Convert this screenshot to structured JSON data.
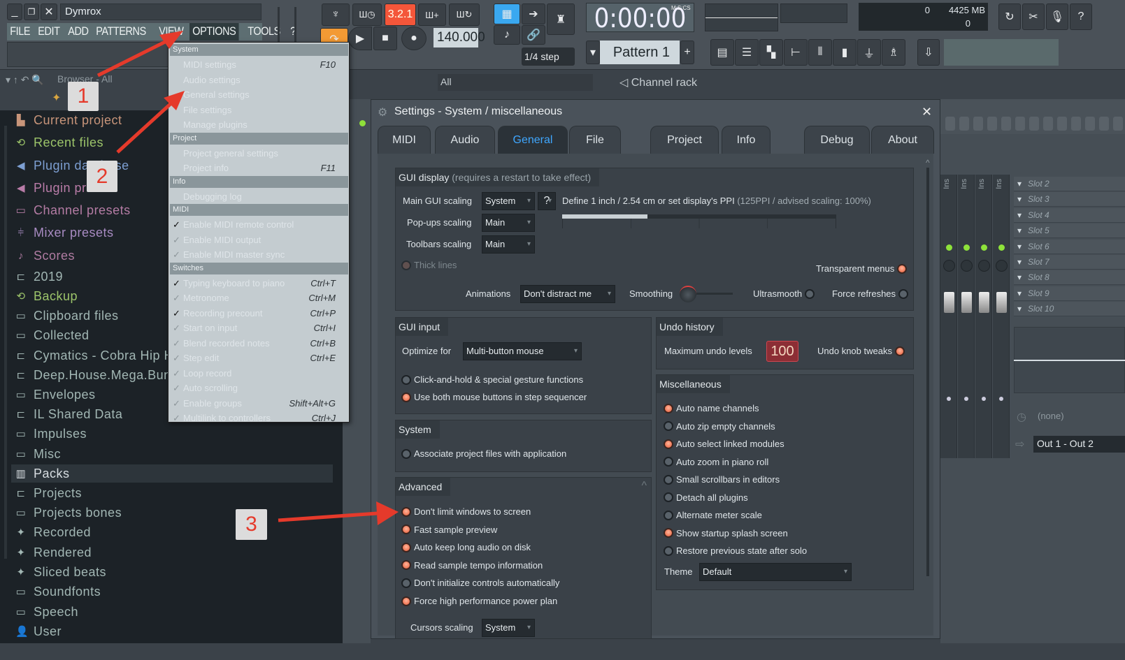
{
  "window": {
    "title": "Dymrox"
  },
  "menubar": [
    "FILE",
    "EDIT",
    "ADD",
    "PATTERNS",
    "VIEW",
    "OPTIONS",
    "TOOLS",
    "?"
  ],
  "menubar_active": "OPTIONS",
  "transport": {
    "bpm": "140.000",
    "time": "0:00:00",
    "time_format": "M:S:CS",
    "song_pos": "3.2.1",
    "step": "1/4 step",
    "pattern": "Pattern 1",
    "cpu": "0",
    "memory": "4425 MB",
    "polyphony": "0"
  },
  "browser": {
    "header": "Browser - All",
    "items": [
      {
        "label": "Current project",
        "icon": "project-icon",
        "color": "#c8957a"
      },
      {
        "label": "Recent files",
        "icon": "recent-folder-icon",
        "color": "#9cc46a"
      },
      {
        "label": "Plugin database",
        "icon": "plugin-icon",
        "color": "#7d9fd2"
      },
      {
        "label": "Plugin presets",
        "icon": "plugin-icon",
        "color": "#b97ca8"
      },
      {
        "label": "Channel presets",
        "icon": "channel-icon",
        "color": "#b47ca4"
      },
      {
        "label": "Mixer presets",
        "icon": "mixer-icon",
        "color": "#a88bc2"
      },
      {
        "label": "Scores",
        "icon": "note-icon",
        "color": "#b07ca2"
      },
      {
        "label": "2019",
        "icon": "folder-plus-icon",
        "color": "#a2b7b4"
      },
      {
        "label": "Backup",
        "icon": "recent-folder-icon",
        "color": "#9cc46a"
      },
      {
        "label": "Clipboard files",
        "icon": "folder-icon",
        "color": "#a2b7b4"
      },
      {
        "label": "Collected",
        "icon": "folder-icon",
        "color": "#a2b7b4"
      },
      {
        "label": "Cymatics - Cobra Hip Hop Sample Pack",
        "icon": "folder-plus-icon",
        "color": "#a2b7b4"
      },
      {
        "label": "Deep.House.Mega.Bundle.",
        "icon": "folder-plus-icon",
        "color": "#a2b7b4"
      },
      {
        "label": "Envelopes",
        "icon": "folder-icon",
        "color": "#a2b7b4"
      },
      {
        "label": "IL Shared Data",
        "icon": "folder-plus-icon",
        "color": "#a2b7b4"
      },
      {
        "label": "Impulses",
        "icon": "folder-icon",
        "color": "#a2b7b4"
      },
      {
        "label": "Misc",
        "icon": "folder-icon",
        "color": "#a2b7b4"
      },
      {
        "label": "Packs",
        "icon": "packs-icon",
        "color": "#d8dee2"
      },
      {
        "label": "Projects",
        "icon": "folder-plus-icon",
        "color": "#a2b7b4"
      },
      {
        "label": "Projects bones",
        "icon": "folder-icon",
        "color": "#a2b7b4"
      },
      {
        "label": "Recorded",
        "icon": "wave-icon",
        "color": "#a2b7b4"
      },
      {
        "label": "Rendered",
        "icon": "wave-icon",
        "color": "#a2b7b4"
      },
      {
        "label": "Sliced beats",
        "icon": "wave-icon",
        "color": "#a2b7b4"
      },
      {
        "label": "Soundfonts",
        "icon": "folder-icon",
        "color": "#a2b7b4"
      },
      {
        "label": "Speech",
        "icon": "folder-icon",
        "color": "#a2b7b4"
      },
      {
        "label": "User",
        "icon": "user-icon",
        "color": "#a2b7b4"
      }
    ]
  },
  "options_menu": [
    {
      "section": "System"
    },
    {
      "label": "MIDI settings",
      "shortcut": "F10"
    },
    {
      "label": "Audio settings"
    },
    {
      "label": "General settings"
    },
    {
      "label": "File settings"
    },
    {
      "label": "Manage plugins"
    },
    {
      "section": "Project"
    },
    {
      "label": "Project general settings"
    },
    {
      "label": "Project info",
      "shortcut": "F11"
    },
    {
      "section": "Info"
    },
    {
      "label": "Debugging log"
    },
    {
      "section": "MIDI"
    },
    {
      "label": "Enable MIDI remote control",
      "checked": true
    },
    {
      "label": "Enable MIDI output",
      "checked": false
    },
    {
      "label": "Enable MIDI master sync",
      "checked": false
    },
    {
      "section": "Switches"
    },
    {
      "label": "Typing keyboard to piano",
      "shortcut": "Ctrl+T",
      "checked": true
    },
    {
      "label": "Metronome",
      "shortcut": "Ctrl+M",
      "checked": false
    },
    {
      "label": "Recording precount",
      "shortcut": "Ctrl+P",
      "checked": true
    },
    {
      "label": "Start on input",
      "shortcut": "Ctrl+I",
      "checked": false
    },
    {
      "label": "Blend recorded notes",
      "shortcut": "Ctrl+B",
      "checked": false
    },
    {
      "label": "Step edit",
      "shortcut": "Ctrl+E",
      "checked": false
    },
    {
      "label": "Loop record",
      "checked": false
    },
    {
      "label": "Auto scrolling",
      "checked": false
    },
    {
      "label": "Enable groups",
      "shortcut": "Shift+Alt+G",
      "checked": false
    },
    {
      "label": "Multilink to controllers",
      "shortcut": "Ctrl+J",
      "checked": false
    }
  ],
  "channel_rack": {
    "filter": "All",
    "title": "Channel rack"
  },
  "settings": {
    "title": "Settings - System / miscellaneous",
    "tabs": [
      "MIDI",
      "Audio",
      "General",
      "File",
      "Project",
      "Info",
      "Debug",
      "About"
    ],
    "active_tab": "General",
    "gui_display": {
      "title": "GUI display",
      "note": "(requires a restart to take effect)",
      "main_scaling_label": "Main GUI scaling",
      "main_scaling": "System",
      "popups_label": "Pop-ups scaling",
      "popups": "Main",
      "toolbars_label": "Toolbars scaling",
      "toolbars": "Main",
      "help": "?",
      "ppi_text": "Define 1 inch / 2.54 cm or set display's PPI",
      "ppi_note": "(125PPI / advised scaling: 100%)",
      "ppi_fraction": 0.31,
      "thick_lines": "Thick lines",
      "transparent_menus": "Transparent menus",
      "animations_label": "Animations",
      "animations": "Don't distract me",
      "smoothing_label": "Smoothing",
      "ultrasmooth": "Ultrasmooth",
      "force_refreshes": "Force refreshes"
    },
    "gui_input": {
      "title": "GUI input",
      "optimize_label": "Optimize for",
      "optimize": "Multi-button mouse",
      "options": [
        {
          "label": "Click-and-hold & special gesture functions",
          "on": false
        },
        {
          "label": "Use both mouse buttons in step sequencer",
          "on": true
        }
      ]
    },
    "system": {
      "title": "System",
      "options": [
        {
          "label": "Associate project files with application",
          "on": false
        }
      ]
    },
    "advanced": {
      "title": "Advanced",
      "options": [
        {
          "label": "Don't limit windows to screen",
          "on": true
        },
        {
          "label": "Fast sample preview",
          "on": true
        },
        {
          "label": "Auto keep long audio on disk",
          "on": true
        },
        {
          "label": "Read sample tempo information",
          "on": true
        },
        {
          "label": "Don't initialize controls automatically",
          "on": false
        },
        {
          "label": "Force high performance power plan",
          "on": true
        }
      ],
      "cursors_label": "Cursors scaling",
      "cursors": "System"
    },
    "undo": {
      "title": "Undo history",
      "max_label": "Maximum undo levels",
      "max_value": "100",
      "knob_tweaks": "Undo knob tweaks"
    },
    "misc": {
      "title": "Miscellaneous",
      "options": [
        {
          "label": "Auto name channels",
          "on": true
        },
        {
          "label": "Auto zip empty channels",
          "on": false
        },
        {
          "label": "Auto select linked modules",
          "on": true
        },
        {
          "label": "Auto zoom in piano roll",
          "on": false
        },
        {
          "label": "Small scrollbars in editors",
          "on": false
        },
        {
          "label": "Detach all plugins",
          "on": false
        },
        {
          "label": "Alternate meter scale",
          "on": false
        },
        {
          "label": "Show startup splash screen",
          "on": true
        },
        {
          "label": "Restore previous state after solo",
          "on": false
        }
      ],
      "theme_label": "Theme",
      "theme": "Default"
    }
  },
  "mixer": {
    "insert_label": "Ins",
    "slots": [
      "Slot 2",
      "Slot 3",
      "Slot 4",
      "Slot 5",
      "Slot 6",
      "Slot 7",
      "Slot 8",
      "Slot 9",
      "Slot 10"
    ],
    "sidechain": "(none)",
    "output": "Out 1 - Out 2"
  },
  "callouts": [
    "1",
    "2",
    "3"
  ],
  "colors": {
    "accent": "#3fa7ff",
    "arrow": "#e53a2b",
    "radio_on": "#e85a35"
  }
}
